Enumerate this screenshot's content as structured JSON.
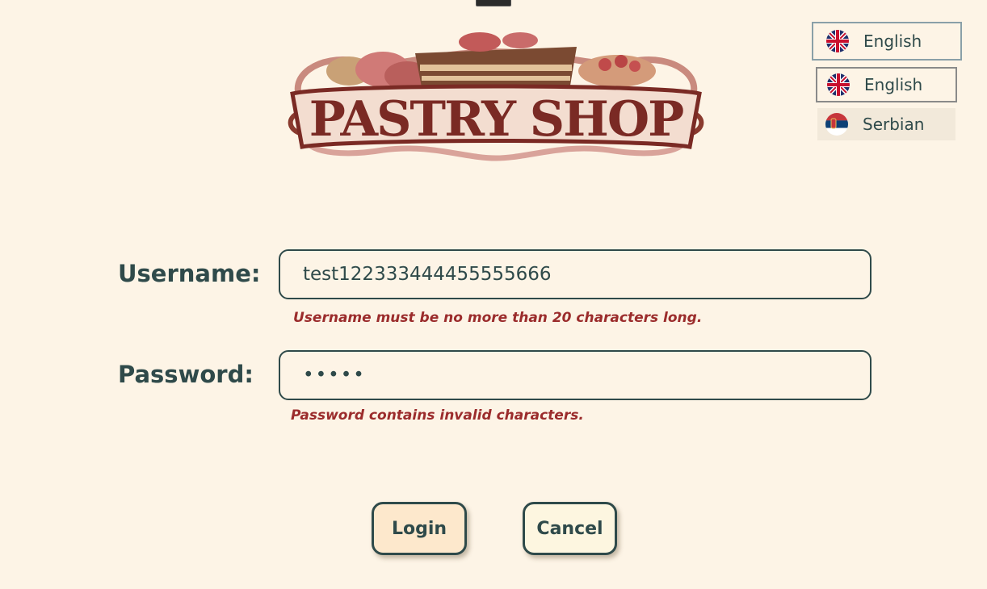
{
  "logo": {
    "text": "PASTRY SHOP",
    "icon": "pastry-shop-logo"
  },
  "language": {
    "current": {
      "label": "English",
      "flag": "uk-flag-icon"
    },
    "options": [
      {
        "label": "English",
        "flag": "uk-flag-icon"
      },
      {
        "label": "Serbian",
        "flag": "serbia-flag-icon"
      }
    ]
  },
  "form": {
    "username_label": "Username:",
    "username_value": "test122333444455555666",
    "username_error": "Username must be no more than 20 characters long.",
    "password_label": "Password:",
    "password_value": "•••••",
    "password_error": "Password contains invalid characters."
  },
  "buttons": {
    "login": "Login",
    "cancel": "Cancel"
  },
  "colors": {
    "background": "#fdf4e6",
    "text": "#2f4a4a",
    "error": "#9b2c2c",
    "login_bg": "#fde8cc",
    "cancel_bg": "#fdf6e0"
  }
}
